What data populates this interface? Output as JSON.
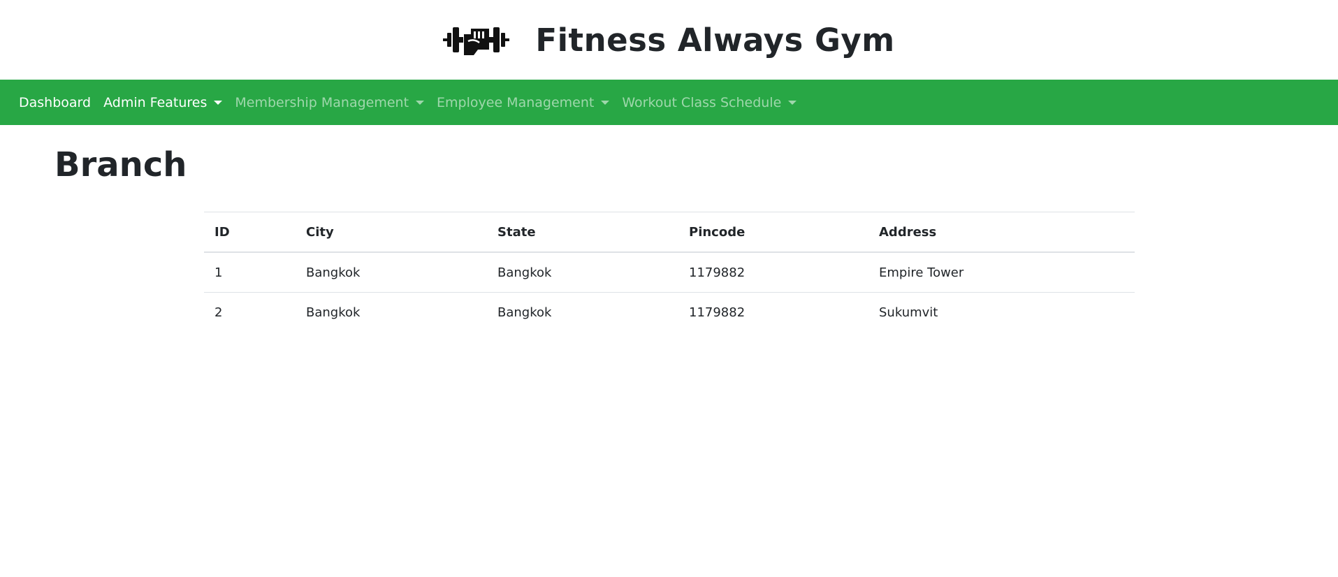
{
  "header": {
    "title": "Fitness Always Gym",
    "logo_icon": "dumbbell-fist-icon"
  },
  "nav": {
    "items": [
      {
        "label": "Dashboard",
        "has_dropdown": false,
        "active": true
      },
      {
        "label": "Admin Features",
        "has_dropdown": true,
        "active": true
      },
      {
        "label": "Membership Management",
        "has_dropdown": true,
        "active": false
      },
      {
        "label": "Employee Management",
        "has_dropdown": true,
        "active": false
      },
      {
        "label": "Workout Class Schedule",
        "has_dropdown": true,
        "active": false
      }
    ]
  },
  "main": {
    "title": "Branch",
    "table": {
      "columns": [
        "ID",
        "City",
        "State",
        "Pincode",
        "Address"
      ],
      "rows": [
        [
          "1",
          "Bangkok",
          "Bangkok",
          "1179882",
          "Empire Tower"
        ],
        [
          "2",
          "Bangkok",
          "Bangkok",
          "1179882",
          "Sukumvit"
        ]
      ]
    }
  },
  "colors": {
    "navbar_bg": "#28a745",
    "text": "#212529",
    "border": "#dee2e6"
  }
}
